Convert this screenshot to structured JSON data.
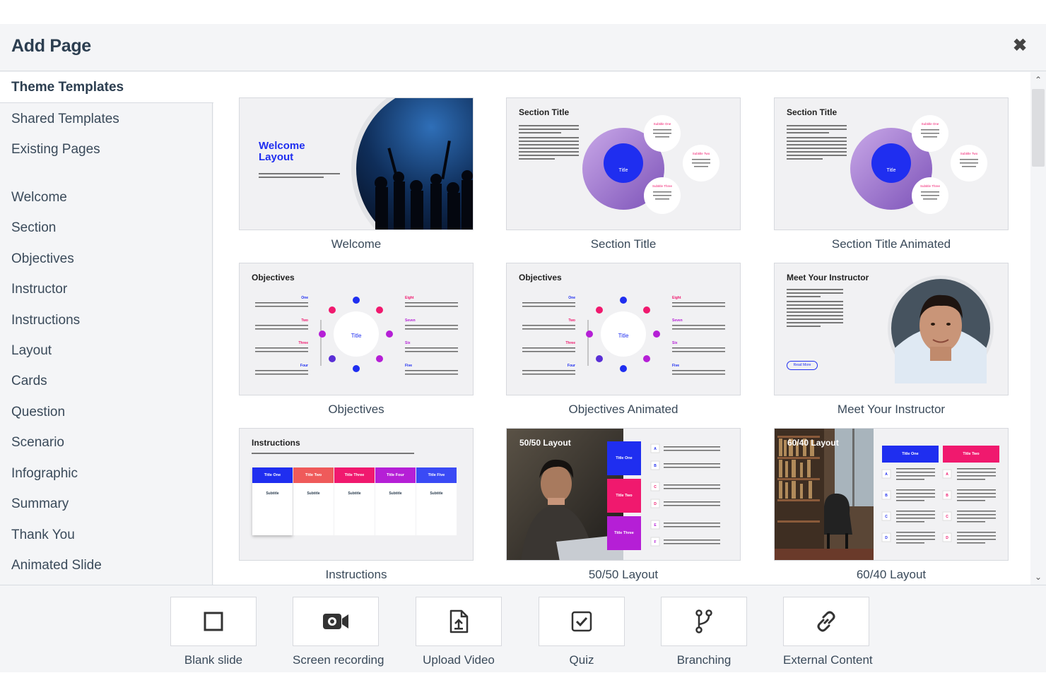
{
  "dialog": {
    "title": "Add Page"
  },
  "sidebar": {
    "tabs": [
      "Theme Templates",
      "Shared Templates",
      "Existing Pages"
    ],
    "categories": [
      "Welcome",
      "Section",
      "Objectives",
      "Instructor",
      "Instructions",
      "Layout",
      "Cards",
      "Question",
      "Scenario",
      "Infographic",
      "Summary",
      "Thank You",
      "Animated Slide"
    ]
  },
  "templates": [
    {
      "label": "Welcome",
      "heading": "Welcome Layout"
    },
    {
      "label": "Section Title",
      "heading": "Section Title",
      "center": "Title",
      "subtitles": [
        "Subtitle One",
        "Subtitle Two",
        "Subtitle Three"
      ]
    },
    {
      "label": "Section Title Animated",
      "heading": "Section Title",
      "center": "Title",
      "subtitles": [
        "Subtitle One",
        "Subtitle Two",
        "Subtitle Three"
      ]
    },
    {
      "label": "Objectives",
      "heading": "Objectives",
      "center": "Title",
      "left": [
        "One",
        "Two",
        "Three",
        "Four"
      ],
      "right": [
        "Eight",
        "Seven",
        "Six",
        "Five"
      ]
    },
    {
      "label": "Objectives Animated",
      "heading": "Objectives",
      "center": "Title",
      "left": [
        "One",
        "Two",
        "Three",
        "Four"
      ],
      "right": [
        "Eight",
        "Seven",
        "Six",
        "Five"
      ]
    },
    {
      "label": "Meet Your Instructor",
      "heading": "Meet Your Instructor",
      "button": "Read More"
    },
    {
      "label": "Instructions",
      "heading": "Instructions",
      "columns": [
        "Title One",
        "Title Two",
        "Title Three",
        "Title Four",
        "Title Five"
      ],
      "subtitle": "Subtitle"
    },
    {
      "label": "50/50 Layout",
      "heading": "50/50 Layout",
      "tiles": [
        "Title One",
        "Title Two",
        "Title Three"
      ],
      "letters": [
        "A",
        "B",
        "C",
        "D",
        "E",
        "F"
      ]
    },
    {
      "label": "60/40 Layout",
      "heading": "60/40 Layout",
      "tiles": [
        "Title One",
        "Title Two"
      ],
      "letters": [
        "A",
        "B",
        "C",
        "D"
      ]
    }
  ],
  "tools": [
    {
      "label": "Blank slide",
      "icon": "square-icon"
    },
    {
      "label": "Screen recording",
      "icon": "video-camera-icon"
    },
    {
      "label": "Upload Video",
      "icon": "file-upload-icon"
    },
    {
      "label": "Quiz",
      "icon": "checkbox-icon"
    },
    {
      "label": "Branching",
      "icon": "branch-icon"
    },
    {
      "label": "External Content",
      "icon": "link-icon"
    }
  ],
  "colors": {
    "blue": "#1f2ef0",
    "pink": "#f0196e",
    "purple": "#b51fd6",
    "coral": "#ef5a5a"
  }
}
